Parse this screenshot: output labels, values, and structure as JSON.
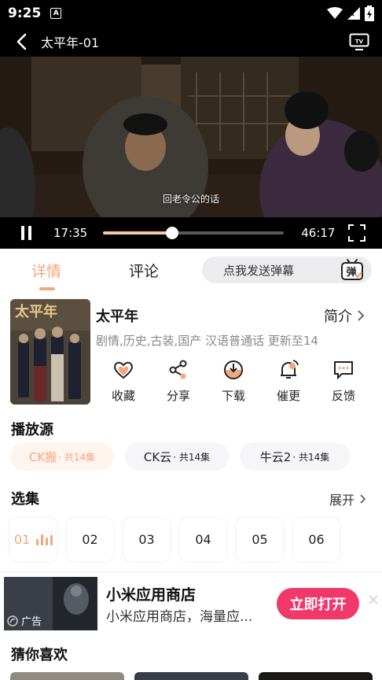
{
  "status_bar": {
    "time": "9:25",
    "notif_letter": "A"
  },
  "header": {
    "title": "太平年-01"
  },
  "video": {
    "subtitle": "回老令公的话",
    "current_time": "17:35",
    "total_time": "46:17",
    "progress_fraction": 0.38
  },
  "tabs": {
    "detail": "详情",
    "comment": "评论",
    "danmu_placeholder": "点我发送弹幕",
    "danmu_icon_text": "弹"
  },
  "show": {
    "name": "太平年",
    "intro": "简介",
    "meta": "剧情,历史,古装,国产 汉语普通话 更新至14",
    "poster_title": "太平年"
  },
  "actions": [
    {
      "label": "收藏",
      "icon": "heart-icon"
    },
    {
      "label": "分享",
      "icon": "share-icon"
    },
    {
      "label": "下载",
      "icon": "download-icon"
    },
    {
      "label": "催更",
      "icon": "bell-icon"
    },
    {
      "label": "反馈",
      "icon": "feedback-icon"
    }
  ],
  "sources": {
    "title": "播放源",
    "items": [
      {
        "name": "CK搬",
        "count": " · 共14集"
      },
      {
        "name": "CK云",
        "count": " · 共14集"
      },
      {
        "name": "牛云2",
        "count": " · 共14集"
      }
    ]
  },
  "episodes": {
    "title": "选集",
    "expand": "展开",
    "items": [
      "01",
      "02",
      "03",
      "04",
      "05",
      "06"
    ]
  },
  "ad": {
    "tag": "广告",
    "title": "小米应用商店",
    "desc": "小米应用商店，海量应...",
    "button": "立即打开"
  },
  "recommend": {
    "title": "猜你喜欢"
  },
  "colors": {
    "accent": "#f5a67c",
    "ad_button": "#f0386b"
  }
}
